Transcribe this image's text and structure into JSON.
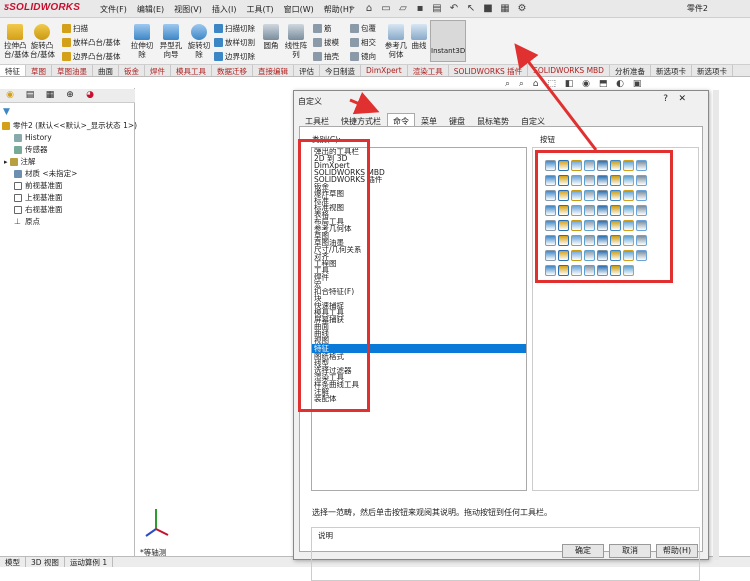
{
  "app": {
    "logo": "SOLIDWORKS",
    "doc_title": "零件2"
  },
  "menus": [
    "文件(F)",
    "编辑(E)",
    "视图(V)",
    "插入(I)",
    "工具(T)",
    "窗口(W)",
    "帮助(H)"
  ],
  "ribbon": {
    "extrude_boss": "拉伸凸\n台/基体",
    "revolve_boss": "旋转凸\n台/基体",
    "sweep": "扫描",
    "loft_boss": "放样凸台/基体",
    "boundary_boss": "边界凸台/基体",
    "extrude_cut": "拉伸切\n除",
    "hole_wizard": "异型孔\n向导",
    "revolve_cut": "旋转切\n除",
    "swept_cut": "扫描切除",
    "lofted_cut": "放样切割",
    "boundary_cut": "边界切除",
    "fillet": "圆角",
    "linear_pattern": "线性阵\n列",
    "rib": "筋",
    "draft": "拔模",
    "shell": "抽壳",
    "wrap": "包覆",
    "intersect": "相交",
    "mirror": "镜向",
    "ref_geometry": "参考几\n何体",
    "curves": "曲线",
    "instant3d": "Instant3D"
  },
  "cmd_tabs": [
    "特征",
    "草图",
    "草图油墨",
    "曲面",
    "钣金",
    "焊件",
    "模具工具",
    "数据迁移",
    "直接编辑",
    "评估",
    "今日制造",
    "DimXpert",
    "渲染工具",
    "SOLIDWORKS 插件",
    "SOLIDWORKS MBD",
    "分析准备",
    "新选项卡",
    "新选项卡"
  ],
  "tree": {
    "root": "零件2 (默认<<默认>_显示状态 1>)",
    "items": [
      "History",
      "传感器",
      "注解",
      "材质 <未指定>",
      "前视基准面",
      "上视基准面",
      "右视基准面",
      "原点"
    ]
  },
  "bottom_tabs": [
    "模型",
    "3D 视图",
    "运动算例 1"
  ],
  "view_label": "*等轴测",
  "dialog": {
    "title": "自定义",
    "help_glyph": "?",
    "close_glyph": "✕",
    "tabs": [
      "工具栏",
      "快捷方式栏",
      "命令",
      "菜单",
      "键盘",
      "鼠标笔势",
      "自定义"
    ],
    "category_label": "类别(C):",
    "buttons_label": "按钮",
    "categories": [
      "弹出的工具栏",
      "2D 到 3D",
      "DimXpert",
      "SOLIDWORKS MBD",
      "SOLIDWORKS 插件",
      "钣金",
      "爆炸草图",
      "标准",
      "标准视图",
      "表格",
      "布局工具",
      "参考几何体",
      "草图",
      "草图油墨",
      "尺寸/几何关系",
      "对齐",
      "工程图",
      "工具",
      "焊件",
      "宏",
      "扣合特征(F)",
      "块",
      "快速捕捉",
      "模具工具",
      "屏幕捕获",
      "曲面",
      "曲线",
      "视图",
      "特征",
      "图纸格式",
      "线型",
      "选择过滤器",
      "渲染工具",
      "样条曲线工具",
      "注解",
      "装配体"
    ],
    "selected_index": 28,
    "description": "选择一范畴，然后单击按钮来观阅其说明。拖动按钮到任何工具栏。",
    "desc_label": "说明",
    "ok": "确定",
    "cancel": "取消",
    "help": "帮助(H)"
  },
  "colors": {
    "accent": "#0a7ad8",
    "annotation": "#e03030",
    "brand": "#c8102e"
  }
}
